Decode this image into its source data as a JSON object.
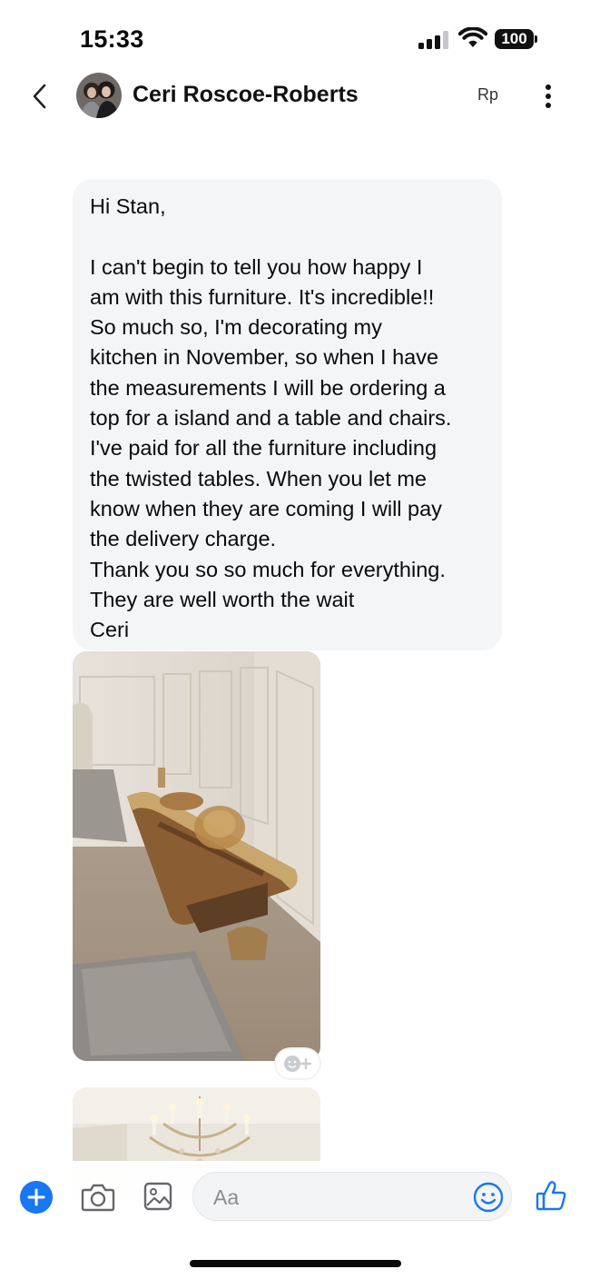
{
  "status_bar": {
    "time": "15:33",
    "battery": "100",
    "icons": [
      "cellular-signal-icon",
      "wifi-icon",
      "battery-icon"
    ]
  },
  "header": {
    "back_icon": "chevron-left-icon",
    "contact_name": "Ceri Roscoe-Roberts",
    "badge": "Rp",
    "more_icon": "vertical-dots-icon"
  },
  "message": {
    "lines": [
      "Hi Stan,",
      "",
      "I can't begin to tell you how happy I",
      "am with this furniture. It's incredible!!",
      "So much so, I'm decorating my",
      "kitchen in November, so when I have",
      "the measurements I will be ordering a",
      "top for a island and a table and chairs.",
      "I've paid for all the furniture including",
      "the twisted tables. When you let me",
      "know when they are coming I will pay",
      "the delivery charge.",
      "Thank you so so much for everything.",
      "They are well worth the wait",
      "Ceri"
    ]
  },
  "attachments": [
    {
      "subject": "live-edge-wood-coffee-table-photo"
    },
    {
      "subject": "crystal-chandelier-photo"
    }
  ],
  "composer": {
    "placeholder": "Aa",
    "icons": [
      "plus-icon",
      "camera-icon",
      "gallery-icon",
      "emoji-icon",
      "thumbs-up-icon"
    ]
  },
  "colors": {
    "accent": "#1877f2",
    "bubble": "#f4f5f7"
  }
}
